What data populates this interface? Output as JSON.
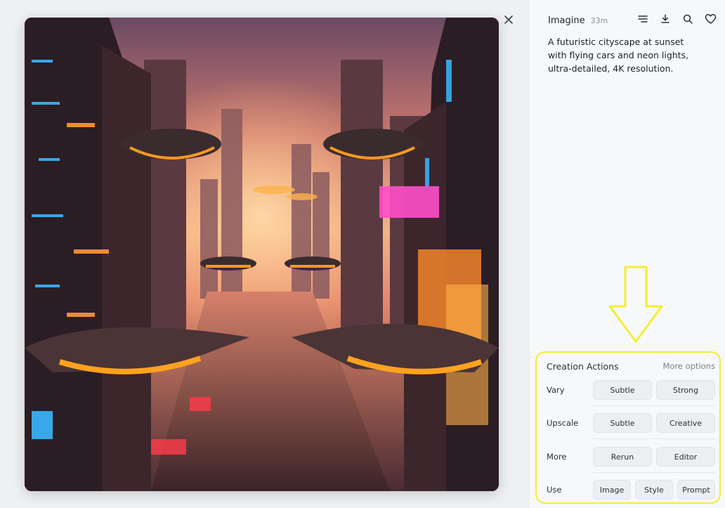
{
  "header": {
    "app_name": "Imagine",
    "time": "33m",
    "icons": [
      "menu-lines-icon",
      "download-icon",
      "search-icon",
      "heart-icon"
    ]
  },
  "prompt": "A futuristic cityscape at sunset with flying cars and neon lights, ultra-detailed, 4K resolution.",
  "actions": {
    "title": "Creation Actions",
    "more_options": "More options",
    "rows": [
      {
        "label": "Vary",
        "buttons": [
          "Subtle",
          "Strong"
        ]
      },
      {
        "label": "Upscale",
        "buttons": [
          "Subtle",
          "Creative"
        ]
      },
      {
        "label": "More",
        "buttons": [
          "Rerun",
          "Editor"
        ]
      },
      {
        "label": "Use",
        "buttons": [
          "Image",
          "Style",
          "Prompt"
        ]
      }
    ]
  },
  "colors": {
    "highlight": "#f2ee33",
    "panel_bg": "#f7f8fa",
    "button_bg": "#eceef1"
  }
}
